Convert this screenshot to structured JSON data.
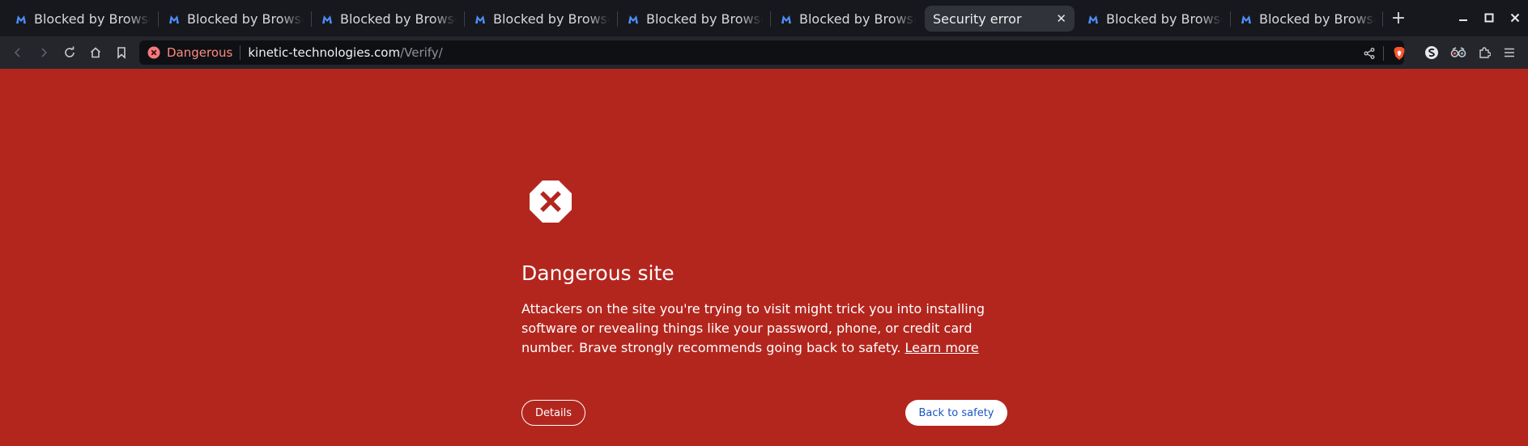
{
  "tabs": [
    {
      "title": "Blocked by Browser Guard",
      "icon": "malwarebytes-icon",
      "active": false
    },
    {
      "title": "Blocked by Browser Guard",
      "icon": "malwarebytes-icon",
      "active": false
    },
    {
      "title": "Blocked by Browser Guard",
      "icon": "malwarebytes-icon",
      "active": false
    },
    {
      "title": "Blocked by Browser Guard",
      "icon": "malwarebytes-icon",
      "active": false
    },
    {
      "title": "Blocked by Browser Guard",
      "icon": "malwarebytes-icon",
      "active": false
    },
    {
      "title": "Blocked by Browser Guard",
      "icon": "malwarebytes-icon",
      "active": false
    },
    {
      "title": "Security error",
      "icon": "",
      "active": true
    },
    {
      "title": "Blocked by Browser Guard",
      "icon": "malwarebytes-icon",
      "active": false
    },
    {
      "title": "Blocked by Browser Guard",
      "icon": "malwarebytes-icon",
      "active": false
    }
  ],
  "newtab_label": "+",
  "close_tab_label": "✕",
  "omnibox": {
    "security_label": "Dangerous",
    "url_host": "kinetic-technologies.com",
    "url_path": "/Verify/"
  },
  "page": {
    "heading": "Dangerous site",
    "message": "Attackers on the site you're trying to visit might trick you into installing software or revealing things like your password, phone, or credit card number. Brave strongly recommends going back to safety.",
    "learn_more": "Learn more",
    "details_button": "Details",
    "back_button": "Back to safety"
  },
  "colors": {
    "page_background": "#b3261e",
    "tabstrip": "#16181d",
    "toolbar": "#24262b",
    "danger_accent": "#ff8a80",
    "link_blue": "#1a56c4"
  }
}
